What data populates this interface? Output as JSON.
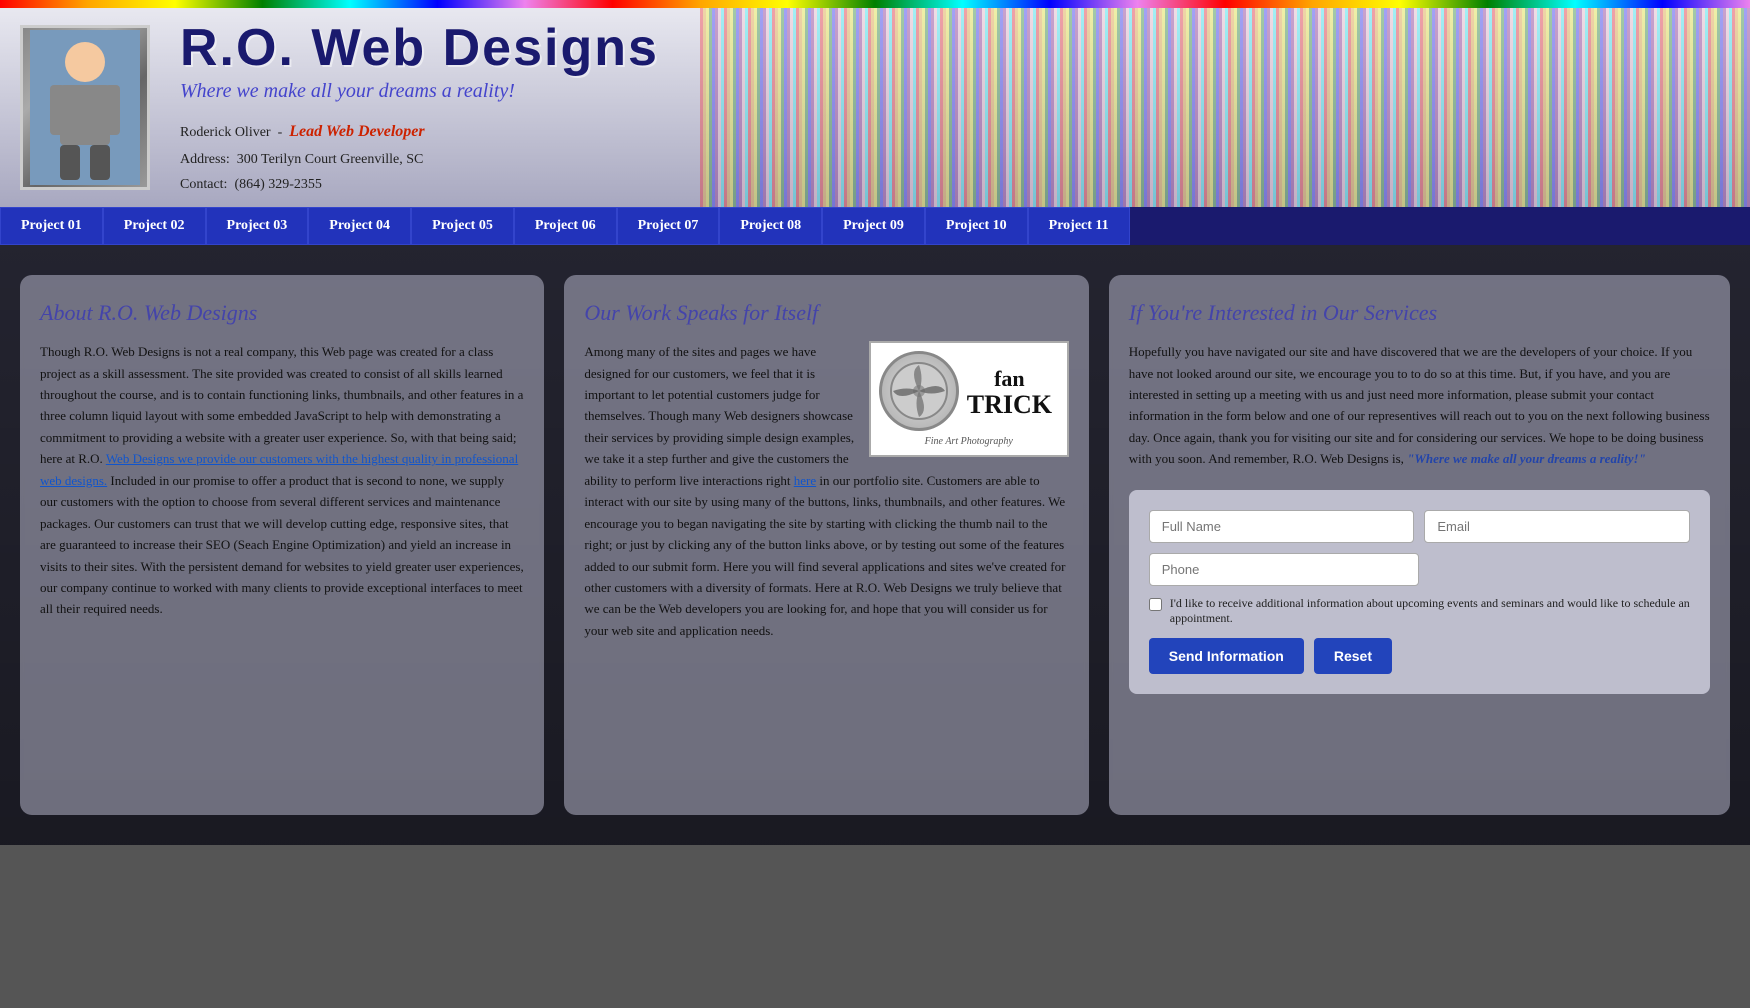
{
  "header": {
    "site_title": "R.O. Web Designs",
    "tagline": "Where we make all your dreams a reality!",
    "developer_label": "Roderick Oliver",
    "developer_title": "Lead Web Developer",
    "address_label": "Address:",
    "address_value": "300 Terilyn Court Greenville, SC",
    "contact_label": "Contact:",
    "contact_value": "(864) 329-2355"
  },
  "nav": {
    "items": [
      "Project 01",
      "Project 02",
      "Project 03",
      "Project 04",
      "Project 05",
      "Project 06",
      "Project 07",
      "Project 08",
      "Project 09",
      "Project 10",
      "Project 11"
    ]
  },
  "col_about": {
    "title": "About R.O. Web Designs",
    "text": "Though R.O. Web Designs is not a real company, this Web page was created for a class project as a skill assessment. The site provided was created to consist of all skills learned throughout the course, and is to contain functioning links, thumbnails, and other features in a three column liquid layout with some embedded JavaScript to help with demonstrating a commitment to providing a website with a greater user experience. So, with that being said; here at R.O. Web Designs we provide our customers with the highest quality in professional web designs. Included in our promise to offer a product that is second to none, we supply our customers with the option to choose from several different services and maintenance packages. Our customers can trust that we will develop cutting edge, responsive sites, that are guaranteed to increase their SEO (Seach Engine Optimization) and yield an increase in visits to their sites. With the persistent demand for websites to yield greater user experiences, our company continue to worked with many clients to provide exceptional interfaces to meet all their required needs."
  },
  "col_work": {
    "title": "Our Work Speaks for Itself",
    "text": "Among many of the sites and pages we have designed for our customers, we feel that it is important to let potential customers judge for themselves. Though many Web designers showcase their services by providing simple design examples, we take it a step further and give the customers the ability to perform live interactions right here in our portfolio site. Customers are able to interact with our site by using many of the buttons, links, thumbnails, and other features. We encourage you to began navigating the site by starting with clicking the thumb nail to the right; or just by clicking any of the button links above, or by testing out some of the features added to our submit form. Here you will find several applications and sites we've created for other customers with a diversity of formats. Here at R.O. Web Designs we truly believe that we can be the Web developers you are looking for, and hope that you will consider us for your web site and application needs.",
    "fantrick_name": "fan TRICK",
    "fantrick_sub": "Fine Art Photography"
  },
  "col_services": {
    "title": "If You're Interested in Our Services",
    "text": "Hopefully you have navigated our site and have discovered that we are the developers of your choice. If you have not looked around our site, we encourage you to to do so at this time. But, if you have, and you are interested in setting up a meeting with us and just need more information, please submit your contact information in the form below and one of our representives will reach out to you on the next following business day. Once again, thank you for visiting our site and for considering our services. We hope to be doing business with you soon. And remember, R.O. Web Designs is,",
    "quote": "\"Where we make all your dreams a reality!\"",
    "form": {
      "full_name_placeholder": "Full Name",
      "email_placeholder": "Email",
      "phone_placeholder": "Phone",
      "checkbox_label": "I'd like to receive additional information about upcoming events and seminars and would like to schedule an appointment.",
      "send_label": "Send Information",
      "reset_label": "Reset"
    }
  }
}
